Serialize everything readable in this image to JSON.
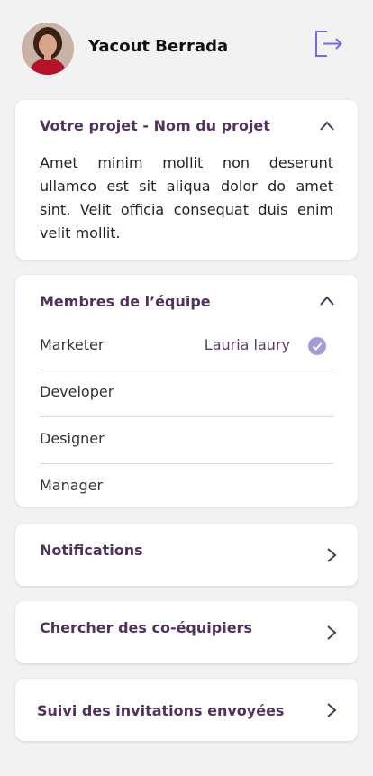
{
  "user": {
    "name": "Yacout Berrada"
  },
  "header": {
    "logout_icon": "logout-icon"
  },
  "project": {
    "title": "Votre projet - Nom du projet",
    "description": "Amet minim mollit non deserunt ullamco est sit aliqua dolor do amet sint. Velit officia consequat duis enim velit mollit."
  },
  "team": {
    "title": "Membres de l’équipe",
    "members": [
      {
        "role": "Marketer",
        "person": "Lauria laury",
        "confirmed": true
      },
      {
        "role": "Developer"
      },
      {
        "role": "Designer"
      },
      {
        "role": "Manager"
      }
    ]
  },
  "nav": {
    "notifications": "Notifications",
    "search": "Chercher des co-équipiers",
    "invitations": "Suivi des invitations envoyées"
  },
  "colors": {
    "accent": "#50325a",
    "icon": "#7c67e0",
    "check": "#a99ad6"
  }
}
